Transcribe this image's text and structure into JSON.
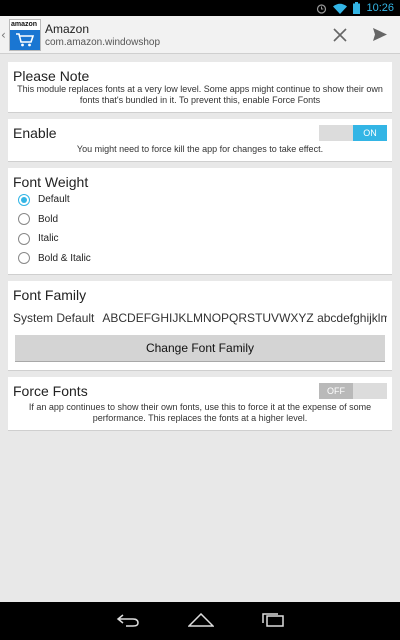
{
  "status_bar": {
    "time": "10:26"
  },
  "app": {
    "logo_text": "amazon",
    "title": "Amazon",
    "package": "com.amazon.windowshop"
  },
  "cards": {
    "note": {
      "title": "Please Note",
      "description": "This module replaces fonts at a very low level. Some apps might continue to show their own fonts that's bundled in it. To prevent this, enable Force Fonts"
    },
    "enable": {
      "title": "Enable",
      "toggle_label": "ON",
      "toggle_on": true,
      "description": "You might need to force kill the app for changes to take effect."
    },
    "font_weight": {
      "title": "Font Weight",
      "options": [
        "Default",
        "Bold",
        "Italic",
        "Bold & Italic"
      ],
      "selected": "Default"
    },
    "font_family": {
      "title": "Font Family",
      "current": "System Default",
      "sample": "ABCDEFGHIJKLMNOPQRSTUVWXYZ abcdefghijklmnopqrstuvwxyz",
      "button_label": "Change Font Family"
    },
    "force_fonts": {
      "title": "Force Fonts",
      "toggle_label": "OFF",
      "toggle_on": false,
      "description": "If an app continues to show their own fonts, use this to force it at the expense of some performance. This replaces the fonts at a higher level."
    }
  },
  "colors": {
    "accent": "#33b5e5",
    "app_icon_blue": "#1a76d2"
  },
  "icons": [
    "wifi-icon",
    "battery-icon",
    "alarm-icon",
    "close-icon",
    "send-icon",
    "back-icon",
    "home-icon",
    "recent-apps-icon"
  ]
}
